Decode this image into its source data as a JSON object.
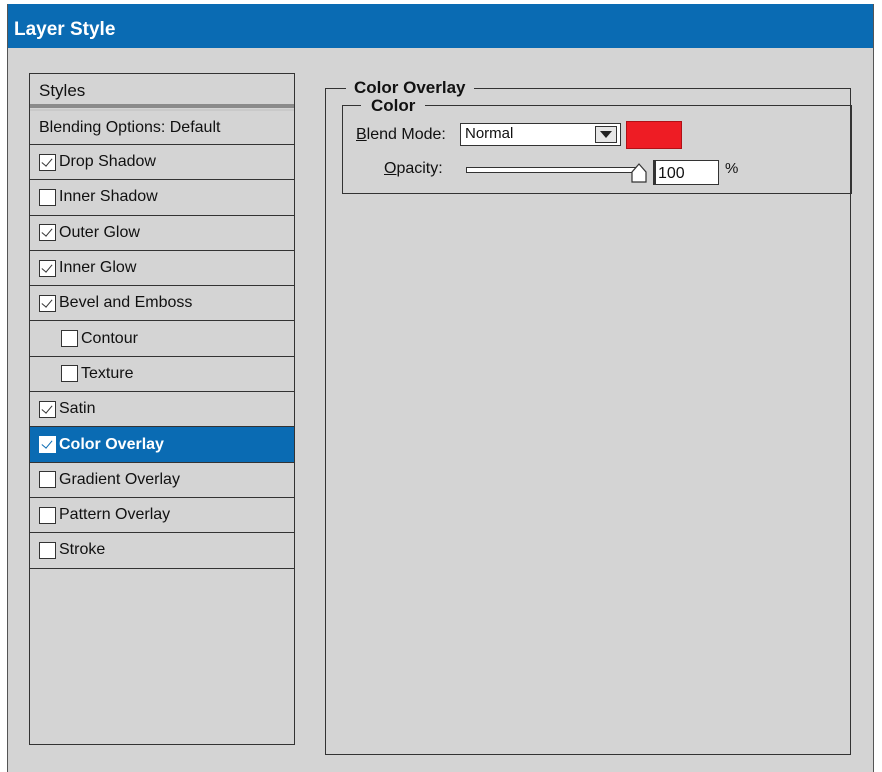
{
  "window": {
    "title": "Layer Style"
  },
  "styles": {
    "header": "Styles",
    "items": [
      {
        "label": "Blending Options: Default",
        "checkbox": false,
        "checked": false,
        "indent": false,
        "selected": false
      },
      {
        "label": "Drop Shadow",
        "checkbox": true,
        "checked": true,
        "indent": false,
        "selected": false
      },
      {
        "label": "Inner Shadow",
        "checkbox": true,
        "checked": false,
        "indent": false,
        "selected": false
      },
      {
        "label": "Outer Glow",
        "checkbox": true,
        "checked": true,
        "indent": false,
        "selected": false
      },
      {
        "label": "Inner Glow",
        "checkbox": true,
        "checked": true,
        "indent": false,
        "selected": false
      },
      {
        "label": "Bevel and Emboss",
        "checkbox": true,
        "checked": true,
        "indent": false,
        "selected": false
      },
      {
        "label": "Contour",
        "checkbox": true,
        "checked": false,
        "indent": true,
        "selected": false
      },
      {
        "label": "Texture",
        "checkbox": true,
        "checked": false,
        "indent": true,
        "selected": false
      },
      {
        "label": "Satin",
        "checkbox": true,
        "checked": true,
        "indent": false,
        "selected": false
      },
      {
        "label": "Color Overlay",
        "checkbox": true,
        "checked": true,
        "indent": false,
        "selected": true
      },
      {
        "label": "Gradient Overlay",
        "checkbox": true,
        "checked": false,
        "indent": false,
        "selected": false
      },
      {
        "label": "Pattern Overlay",
        "checkbox": true,
        "checked": false,
        "indent": false,
        "selected": false
      },
      {
        "label": "Stroke",
        "checkbox": true,
        "checked": false,
        "indent": false,
        "selected": false
      }
    ]
  },
  "color_overlay": {
    "section_title": "Color Overlay",
    "group_title": "Color",
    "blend_mode_label_mnemonic": "B",
    "blend_mode_label_rest": "lend Mode:",
    "blend_mode_value": "Normal",
    "overlay_color": "#ee1c24",
    "opacity_label_mnemonic": "O",
    "opacity_label_rest": "pacity:",
    "opacity_value": "100",
    "opacity_unit": "%"
  },
  "colors": {
    "accent": "#0a6bb3",
    "panel_bg": "#d4d4d4"
  },
  "icons": {
    "dropdown": "chevron-down-icon",
    "slider_thumb": "slider-thumb-icon"
  }
}
